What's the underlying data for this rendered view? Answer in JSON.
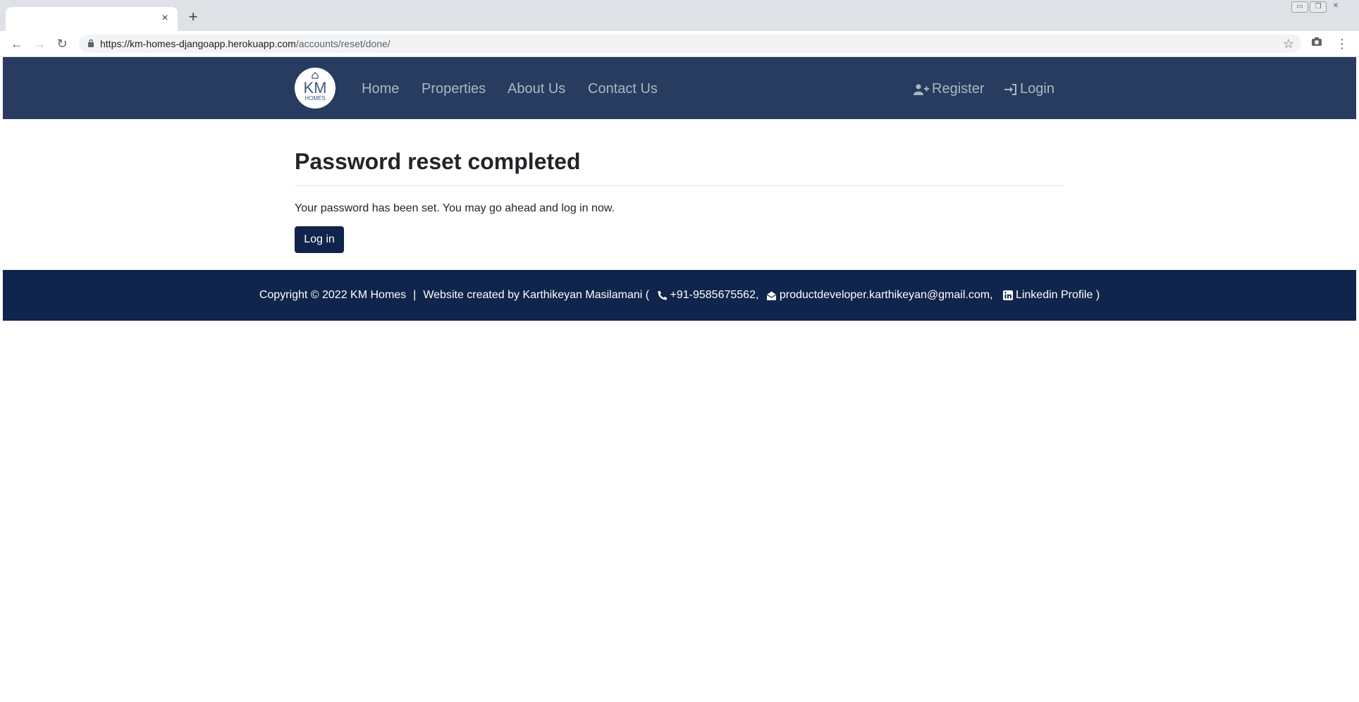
{
  "browser": {
    "tab_title": "",
    "tab_close": "×",
    "new_tab": "+",
    "url_host": "https://km-homes-djangoapp.herokuapp.com",
    "url_path": "/accounts/reset/done/",
    "back_glyph": "←",
    "forward_glyph": "→",
    "reload_glyph": "↻",
    "star_glyph": "☆",
    "menu_glyph": "⋮"
  },
  "site": {
    "logo": {
      "text": "KM",
      "sub": "HOMES"
    },
    "nav": {
      "home": "Home",
      "properties": "Properties",
      "about": "About Us",
      "contact": "Contact Us",
      "register": "Register",
      "login": "Login"
    }
  },
  "page": {
    "title": "Password reset completed",
    "message": "Your password has been set. You may go ahead and log in now.",
    "login_button": "Log in"
  },
  "footer": {
    "copyright": "Copyright © 2022 KM Homes",
    "separator": "|",
    "created_by": "Website created by Karthikeyan Masilamani (",
    "phone": "+91-9585675562,",
    "email": "productdeveloper.karthikeyan@gmail.com,",
    "linkedin": "Linkedin Profile",
    "close_paren": ")"
  },
  "colors": {
    "navbar": "#273c5f",
    "footer": "#10254b",
    "button": "#10254b",
    "nav_text": "#aeb6c2"
  },
  "icons": [
    "lock-icon",
    "star-icon",
    "camera-icon",
    "menu-icon",
    "user-plus-icon",
    "sign-in-icon",
    "phone-icon",
    "envelope-icon",
    "linkedin-icon"
  ]
}
